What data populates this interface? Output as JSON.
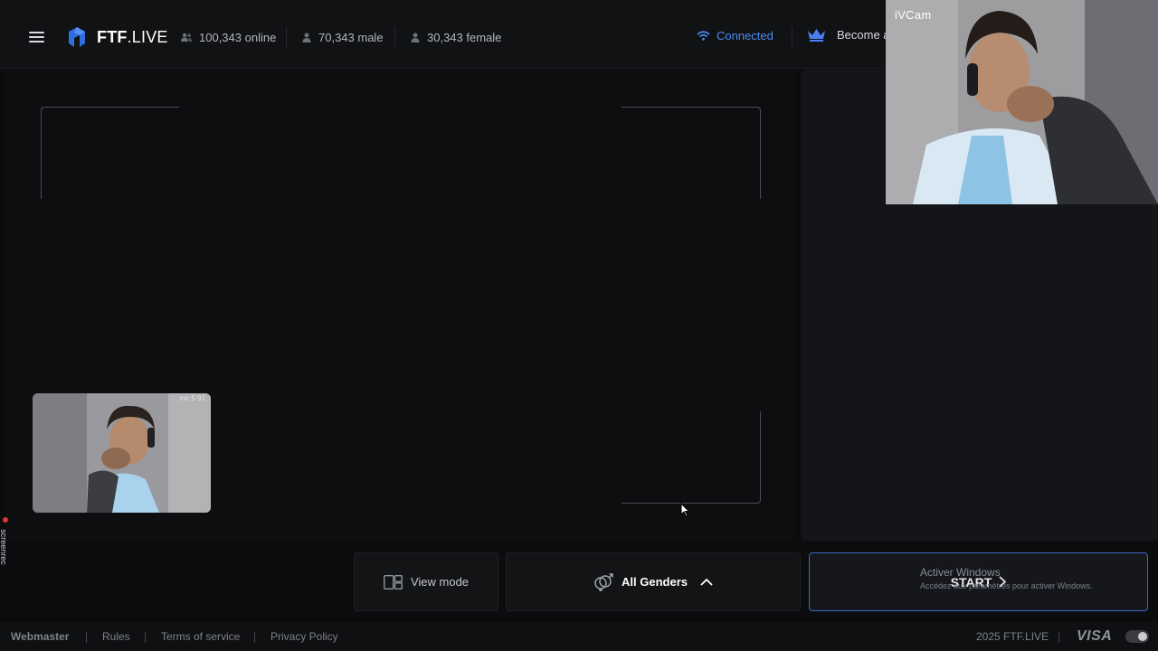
{
  "header": {
    "logo_text_bold": "FTF",
    "logo_text_rest": ".LIVE",
    "stats": {
      "online": "100,343 online",
      "male": "70,343 male",
      "female": "30,343 female"
    },
    "connection_status": "Connected",
    "become_label": "Become a"
  },
  "overlay": {
    "ivcam_label": "iVCam",
    "self_cam_label": "mc 5 91"
  },
  "controls": {
    "view_mode_label": "View mode",
    "gender_filter_label": "All Genders",
    "start_label": "START"
  },
  "watermark": {
    "title": "Activer Windows",
    "subtitle": "Accédez aux paramètres pour activer Windows."
  },
  "recording_badge": "screenrec",
  "footer": {
    "webmaster": "Webmaster",
    "rules": "Rules",
    "terms": "Terms of service",
    "privacy": "Privacy Policy",
    "copyright": "2025 FTF.LIVE",
    "payment": "VISA"
  },
  "colors": {
    "accent_blue": "#4a8cf5",
    "start_border": "#3f66c9",
    "crown": "#4a7ff0",
    "background": "#0b0c0e"
  },
  "icons": [
    "menu-icon",
    "logo-icon",
    "users-icon",
    "user-icon",
    "wifi-icon",
    "crown-icon",
    "view-mode-icon",
    "gender-icon",
    "chevron-up-icon",
    "chevron-right-icon"
  ]
}
